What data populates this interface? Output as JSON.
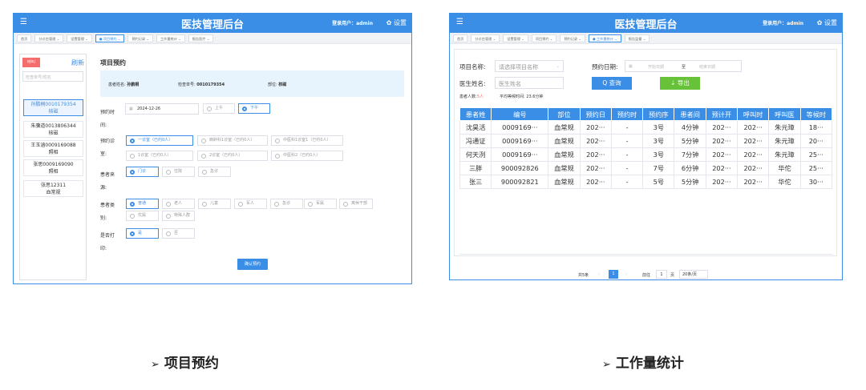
{
  "left": {
    "app_title": "医技管理后台",
    "user_text": "登录用户：admin",
    "settings_label": "设置",
    "tabs": [
      "首页",
      "分诊台管理 ⌄",
      "设置管理 ⌄",
      "● 项目预约 ⌄",
      "预约记录 ⌄",
      "工作量统计 ⌄",
      "报告医疗 ⌄"
    ],
    "active_tab": 3,
    "sidebar": {
      "call_button": "呼叫",
      "refresh": "刷新",
      "search_placeholder": "检查单号/姓名",
      "patients": [
        {
          "name": "孙鹏桐0010179354",
          "dept": "核磁",
          "selected": true
        },
        {
          "name": "朱骥道0013806344",
          "dept": "核磁",
          "selected": false
        },
        {
          "name": "王玉涵0009169088",
          "dept": "照相",
          "selected": false
        },
        {
          "name": "张思0009169090",
          "dept": "照相",
          "selected": false
        },
        {
          "name": "张思12311",
          "dept": "血常规",
          "selected": false
        }
      ]
    },
    "section_title": "项目预约",
    "info": {
      "name_label": "患者姓名:",
      "name_value": "孙鹏桐",
      "no_label": "检查单号:",
      "no_value": "0010179354",
      "dept_label": "部位:",
      "dept_value": "核磁"
    },
    "form": {
      "time_label": "预约时间:",
      "date_value": "2024-12-26",
      "am": "上午",
      "pm": "下午",
      "room_label": "预约诊室:",
      "rooms": [
        "一诊室（已约0人）",
        "麻醉科1诊室（已约0人）",
        "中医科1诊室1（已约0人）",
        "1诊室（已约0人）",
        "2诊室（已约0人）",
        "中医科2（已约0人）"
      ],
      "source_label": "患者来源:",
      "sources": [
        "门诊",
        "住院",
        "急诊"
      ],
      "type_label": "患者类别:",
      "types": [
        "普通",
        "老人",
        "儿童",
        "军人",
        "急诊",
        "军属",
        "离休干部",
        "优属",
        "特殊人群"
      ],
      "print_label": "是否打印:",
      "prints": [
        "是",
        "否"
      ],
      "confirm": "确认预约"
    }
  },
  "right": {
    "app_title": "医技管理后台",
    "user_text": "登录用户：admin",
    "settings_label": "设置",
    "tabs": [
      "首页",
      "分诊台管理 ⌄",
      "设置管理 ⌄",
      "项目预约 ⌄",
      "预约记录 ⌄",
      "● 工作量统计 ⌄",
      "报告监督 ⌄"
    ],
    "active_tab": 5,
    "filters": {
      "project_label": "项目名称:",
      "project_placeholder": "请选择项目名称",
      "date_label": "预约日期:",
      "date_start": "开始日期",
      "date_to": "至",
      "date_end": "结束日期",
      "doctor_label": "医生姓名:",
      "doctor_placeholder": "医生姓名",
      "query": "查询",
      "export": "导出"
    },
    "stats": {
      "count_label": "患者人数:",
      "count_value": "5人",
      "avg_label": "平均等候时间:",
      "avg_value": "23.6分钟"
    },
    "table": {
      "headers": [
        "患者姓",
        "编号",
        "部位",
        "预约日",
        "预约时",
        "预约序",
        "患者间",
        "预计开",
        "呼叫时",
        "呼叫医",
        "等候时"
      ],
      "rows": [
        [
          "沈昊活",
          "0009169···",
          "血常规",
          "202···",
          "-",
          "3号",
          "4分钟",
          "202···",
          "202···",
          "朱元璋",
          "18···"
        ],
        [
          "冯通证",
          "0009169···",
          "血常规",
          "202···",
          "-",
          "3号",
          "5分钟",
          "202···",
          "202···",
          "朱元璋",
          "20···"
        ],
        [
          "何天洌",
          "0009169···",
          "血常规",
          "202···",
          "-",
          "3号",
          "7分钟",
          "202···",
          "202···",
          "朱元璋",
          "25···"
        ],
        [
          "三胖",
          "900092826",
          "血常规",
          "202···",
          "-",
          "7号",
          "6分钟",
          "202···",
          "202···",
          "华佗",
          "25···"
        ],
        [
          "张三",
          "900092821",
          "血常规",
          "202···",
          "-",
          "5号",
          "5分钟",
          "202···",
          "202···",
          "华佗",
          "30···"
        ]
      ]
    },
    "pager": {
      "total": "共5条",
      "page": "1",
      "goto": "前往",
      "goto_page": "1",
      "page_unit": "页",
      "size": "20条/页"
    }
  },
  "captions": {
    "left": "项目预约",
    "right": "工作量统计"
  }
}
